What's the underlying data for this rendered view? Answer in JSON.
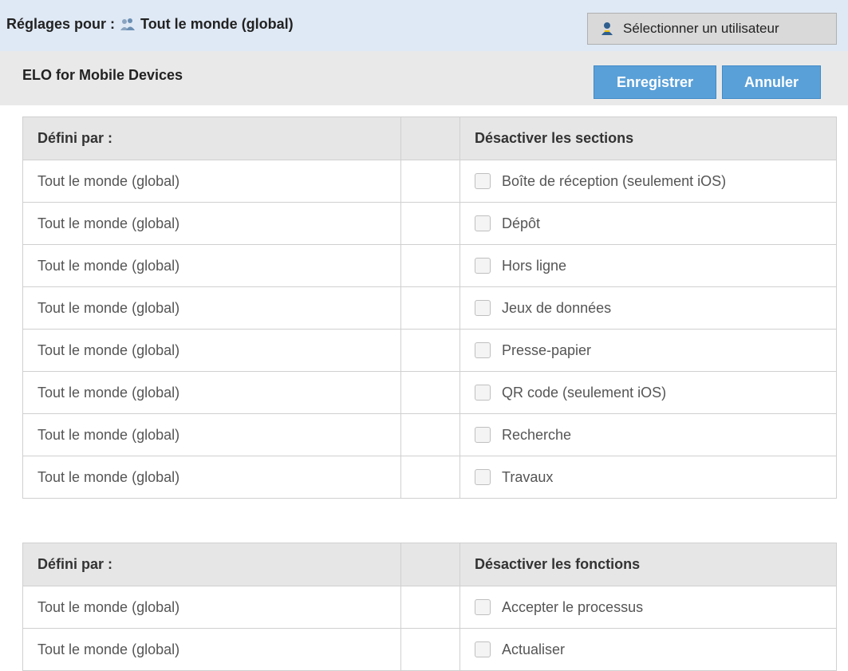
{
  "header": {
    "settings_label": "Réglages pour :",
    "scope_name": "Tout le monde (global)",
    "select_user_label": "Sélectionner un utilisateur"
  },
  "app_bar": {
    "title": "ELO for Mobile Devices",
    "save_label": "Enregistrer",
    "cancel_label": "Annuler"
  },
  "sections_table": {
    "col_defined_by": "Défini par :",
    "col_disable": "Désactiver les sections",
    "rows": [
      {
        "defined_by": "Tout le monde (global)",
        "label": "Boîte de réception (seulement iOS)",
        "checked": false
      },
      {
        "defined_by": "Tout le monde (global)",
        "label": "Dépôt",
        "checked": false
      },
      {
        "defined_by": "Tout le monde (global)",
        "label": "Hors ligne",
        "checked": false
      },
      {
        "defined_by": "Tout le monde (global)",
        "label": "Jeux de données",
        "checked": false
      },
      {
        "defined_by": "Tout le monde (global)",
        "label": "Presse-papier",
        "checked": false
      },
      {
        "defined_by": "Tout le monde (global)",
        "label": "QR code (seulement iOS)",
        "checked": false
      },
      {
        "defined_by": "Tout le monde (global)",
        "label": "Recherche",
        "checked": false
      },
      {
        "defined_by": "Tout le monde (global)",
        "label": "Travaux",
        "checked": false
      }
    ]
  },
  "functions_table": {
    "col_defined_by": "Défini par :",
    "col_disable": "Désactiver les fonctions",
    "rows": [
      {
        "defined_by": "Tout le monde (global)",
        "label": "Accepter le processus",
        "checked": false
      },
      {
        "defined_by": "Tout le monde (global)",
        "label": "Actualiser",
        "checked": false
      }
    ]
  },
  "colors": {
    "header_bg": "#dfe9f5",
    "appbar_bg": "#e9e9e9",
    "primary_button": "#5aa0d8",
    "table_header_bg": "#e6e6e6"
  },
  "icons": {
    "scope": "users-group-icon",
    "select_user": "user-icon"
  }
}
